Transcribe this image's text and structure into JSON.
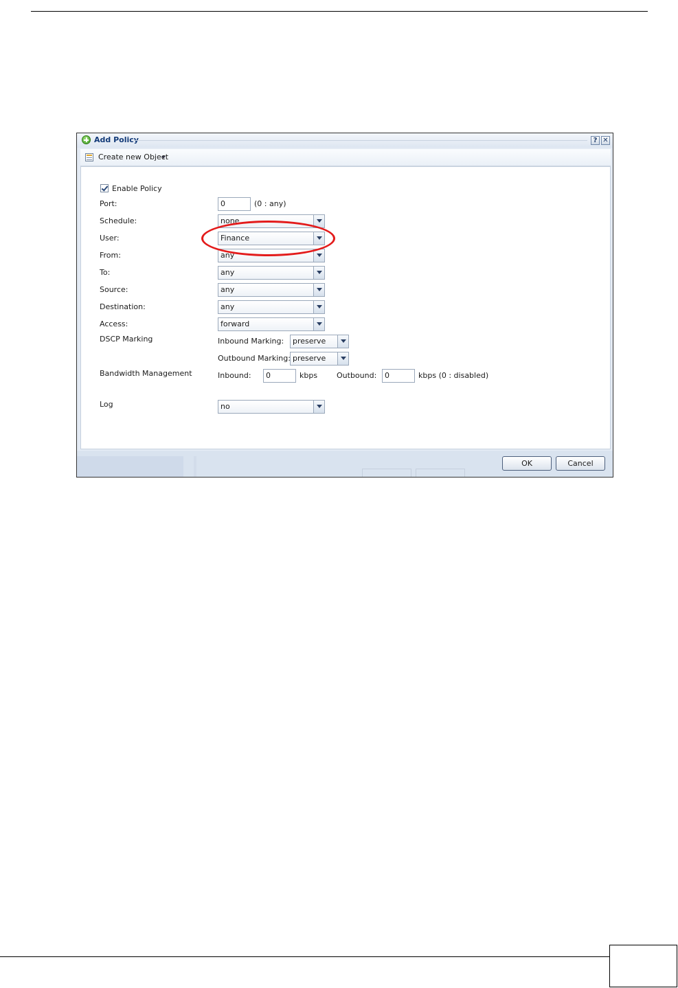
{
  "dialog": {
    "title": "Add Policy",
    "help_label": "?",
    "close_label": "✕",
    "toolbar": {
      "create_label": "Create new Object"
    }
  },
  "form": {
    "enable_policy": {
      "label": "Enable Policy",
      "checked": true
    },
    "port": {
      "label": "Port:",
      "value": "0",
      "hint": "(0 : any)"
    },
    "schedule": {
      "label": "Schedule:",
      "value": "none"
    },
    "user": {
      "label": "User:",
      "value": "Finance"
    },
    "from": {
      "label": "From:",
      "value": "any"
    },
    "to": {
      "label": "To:",
      "value": "any"
    },
    "source": {
      "label": "Source:",
      "value": "any"
    },
    "destination": {
      "label": "Destination:",
      "value": "any"
    },
    "access": {
      "label": "Access:",
      "value": "forward"
    },
    "dscp": {
      "label": "DSCP Marking",
      "inbound_label": "Inbound Marking:",
      "inbound_value": "preserve",
      "outbound_label": "Outbound Marking:",
      "outbound_value": "preserve"
    },
    "bandwidth": {
      "label": "Bandwidth Management",
      "inbound_label": "Inbound:",
      "inbound_value": "0",
      "inbound_unit": "kbps",
      "outbound_label": "Outbound:",
      "outbound_value": "0",
      "outbound_unit": "kbps (0 : disabled)"
    },
    "log": {
      "label": "Log",
      "value": "no"
    }
  },
  "buttons": {
    "ok": "OK",
    "cancel": "Cancel"
  },
  "colors": {
    "highlight": "#e31b1b",
    "title": "#123a78"
  }
}
